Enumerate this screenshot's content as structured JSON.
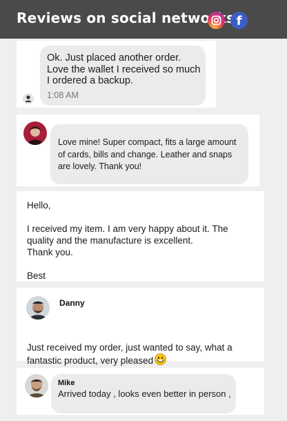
{
  "header": {
    "title": "Reviews on social networks",
    "icons": [
      "instagram-icon",
      "facebook-icon"
    ],
    "facebook_glyph": "f",
    "colors": {
      "background": "#4a4a4a",
      "facebook": "#3b5ec9"
    }
  },
  "reviews": [
    {
      "text": "Ok. Just placed another order.\nLove the wallet I received so much\nI ordered a backup.",
      "time": "1:08 AM"
    },
    {
      "text": "Love mine!  Super compact, fits a large amount\nof cards, bills and change.  Leather and snaps\nare lovely.  Thank you!"
    },
    {
      "text": "Hello,\n\nI received my item. I am very happy about it. The\nquality and the manufacture is excellent.\nThank you.\n\nBest"
    },
    {
      "name": "Danny",
      "text": "Just received my order, just wanted to say, what a\nfantastic product, very pleased"
    },
    {
      "name": "Mike",
      "text": "Arrived today , looks even better in person ,"
    }
  ]
}
